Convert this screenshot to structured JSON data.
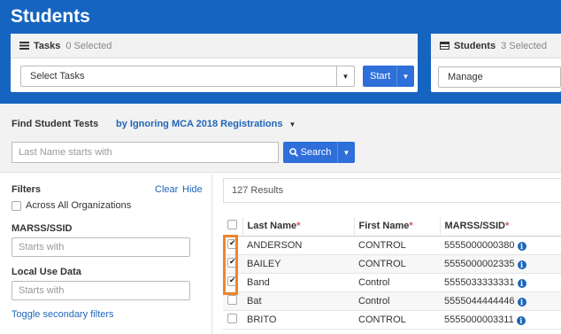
{
  "app": {
    "title": "Students"
  },
  "tasks_panel": {
    "icon": "list-icon",
    "title": "Tasks",
    "count": "0 Selected",
    "select_value": "Select Tasks",
    "start_label": "Start"
  },
  "students_panel": {
    "icon": "table-icon",
    "title": "Students",
    "count": "3 Selected",
    "select_value": "Manage"
  },
  "find": {
    "title": "Find Student Tests",
    "filter_label": "by Ignoring MCA 2018 Registrations",
    "search_placeholder": "Last Name starts with",
    "search_label": "Search"
  },
  "filters": {
    "title": "Filters",
    "clear": "Clear",
    "hide": "Hide",
    "across_label": "Across All Organizations",
    "marss_label": "MARSS/SSID",
    "marss_placeholder": "Starts with",
    "local_label": "Local Use Data",
    "local_placeholder": "Starts with",
    "toggle": "Toggle secondary filters"
  },
  "results": {
    "count_text": "127 Results",
    "columns": [
      {
        "label": "Last Name",
        "req": "*"
      },
      {
        "label": "First Name",
        "req": "*"
      },
      {
        "label": "MARSS/SSID",
        "req": "*"
      }
    ],
    "rows": [
      {
        "checked": true,
        "last": "ANDERSON",
        "first": "CONTROL",
        "ssid": "5555000000380"
      },
      {
        "checked": true,
        "last": "BAILEY",
        "first": "CONTROL",
        "ssid": "5555000002335"
      },
      {
        "checked": true,
        "last": "Band",
        "first": "Control",
        "ssid": "5555033333331"
      },
      {
        "checked": false,
        "last": "Bat",
        "first": "Control",
        "ssid": "5555044444446"
      },
      {
        "checked": false,
        "last": "BRITO",
        "first": "CONTROL",
        "ssid": "5555000003311"
      }
    ]
  },
  "colors": {
    "header": "#1565c0",
    "button": "#2f6fd9",
    "link": "#1e66b8",
    "highlight": "#f0842b"
  }
}
